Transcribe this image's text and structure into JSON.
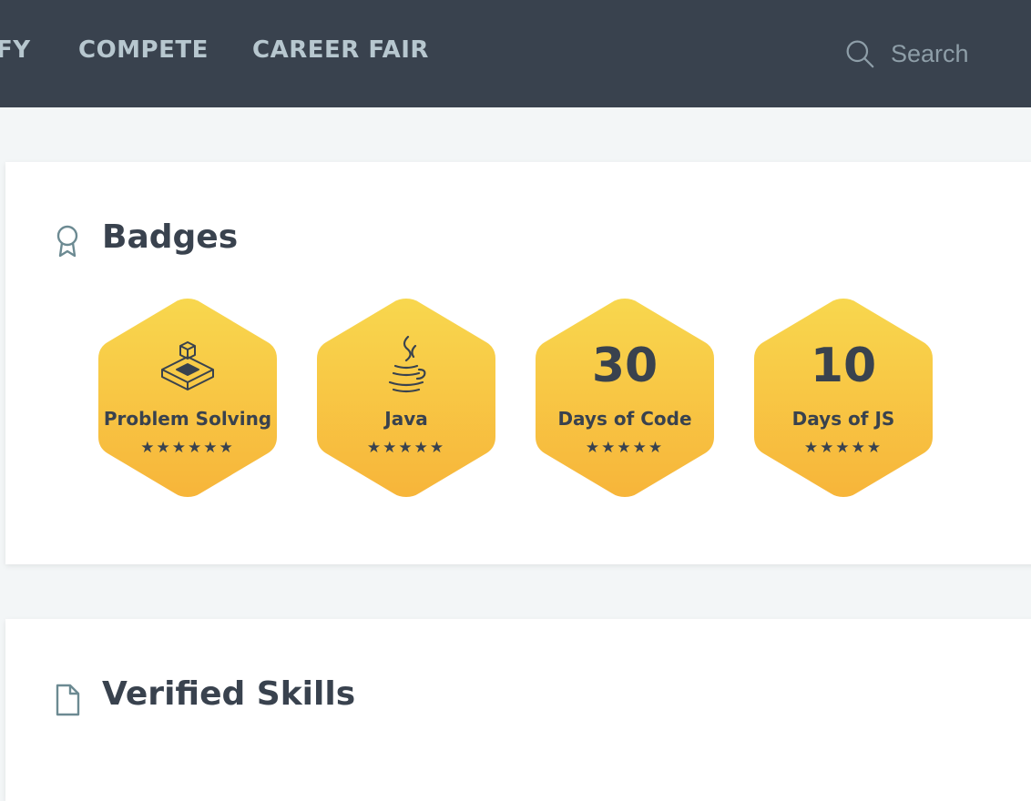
{
  "nav": {
    "partial_label": "FY",
    "items": [
      "COMPETE",
      "CAREER FAIR"
    ],
    "search_placeholder": "Search"
  },
  "badges_section": {
    "title": "Badges",
    "icon": "award-ribbon-icon",
    "badges": [
      {
        "label": "Problem Solving",
        "icon": "cube-puzzle-icon",
        "stars": "★★★★★★",
        "star_count": 6
      },
      {
        "label": "Java",
        "icon": "java-cup-icon",
        "stars": "★★★★★",
        "star_count": 5
      },
      {
        "number": "30",
        "label": "Days of Code",
        "stars": "★★★★★",
        "star_count": 5
      },
      {
        "number": "10",
        "label": "Days of JS",
        "stars": "★★★★★",
        "star_count": 5
      }
    ]
  },
  "skills_section": {
    "title": "Verified Skills",
    "icon": "document-icon"
  },
  "colors": {
    "nav_bg": "#39424e",
    "nav_text": "#b7c7cf",
    "badge_gold_top": "#f8d34d",
    "badge_gold_bottom": "#f7b83a",
    "text_dark": "#39424e"
  }
}
